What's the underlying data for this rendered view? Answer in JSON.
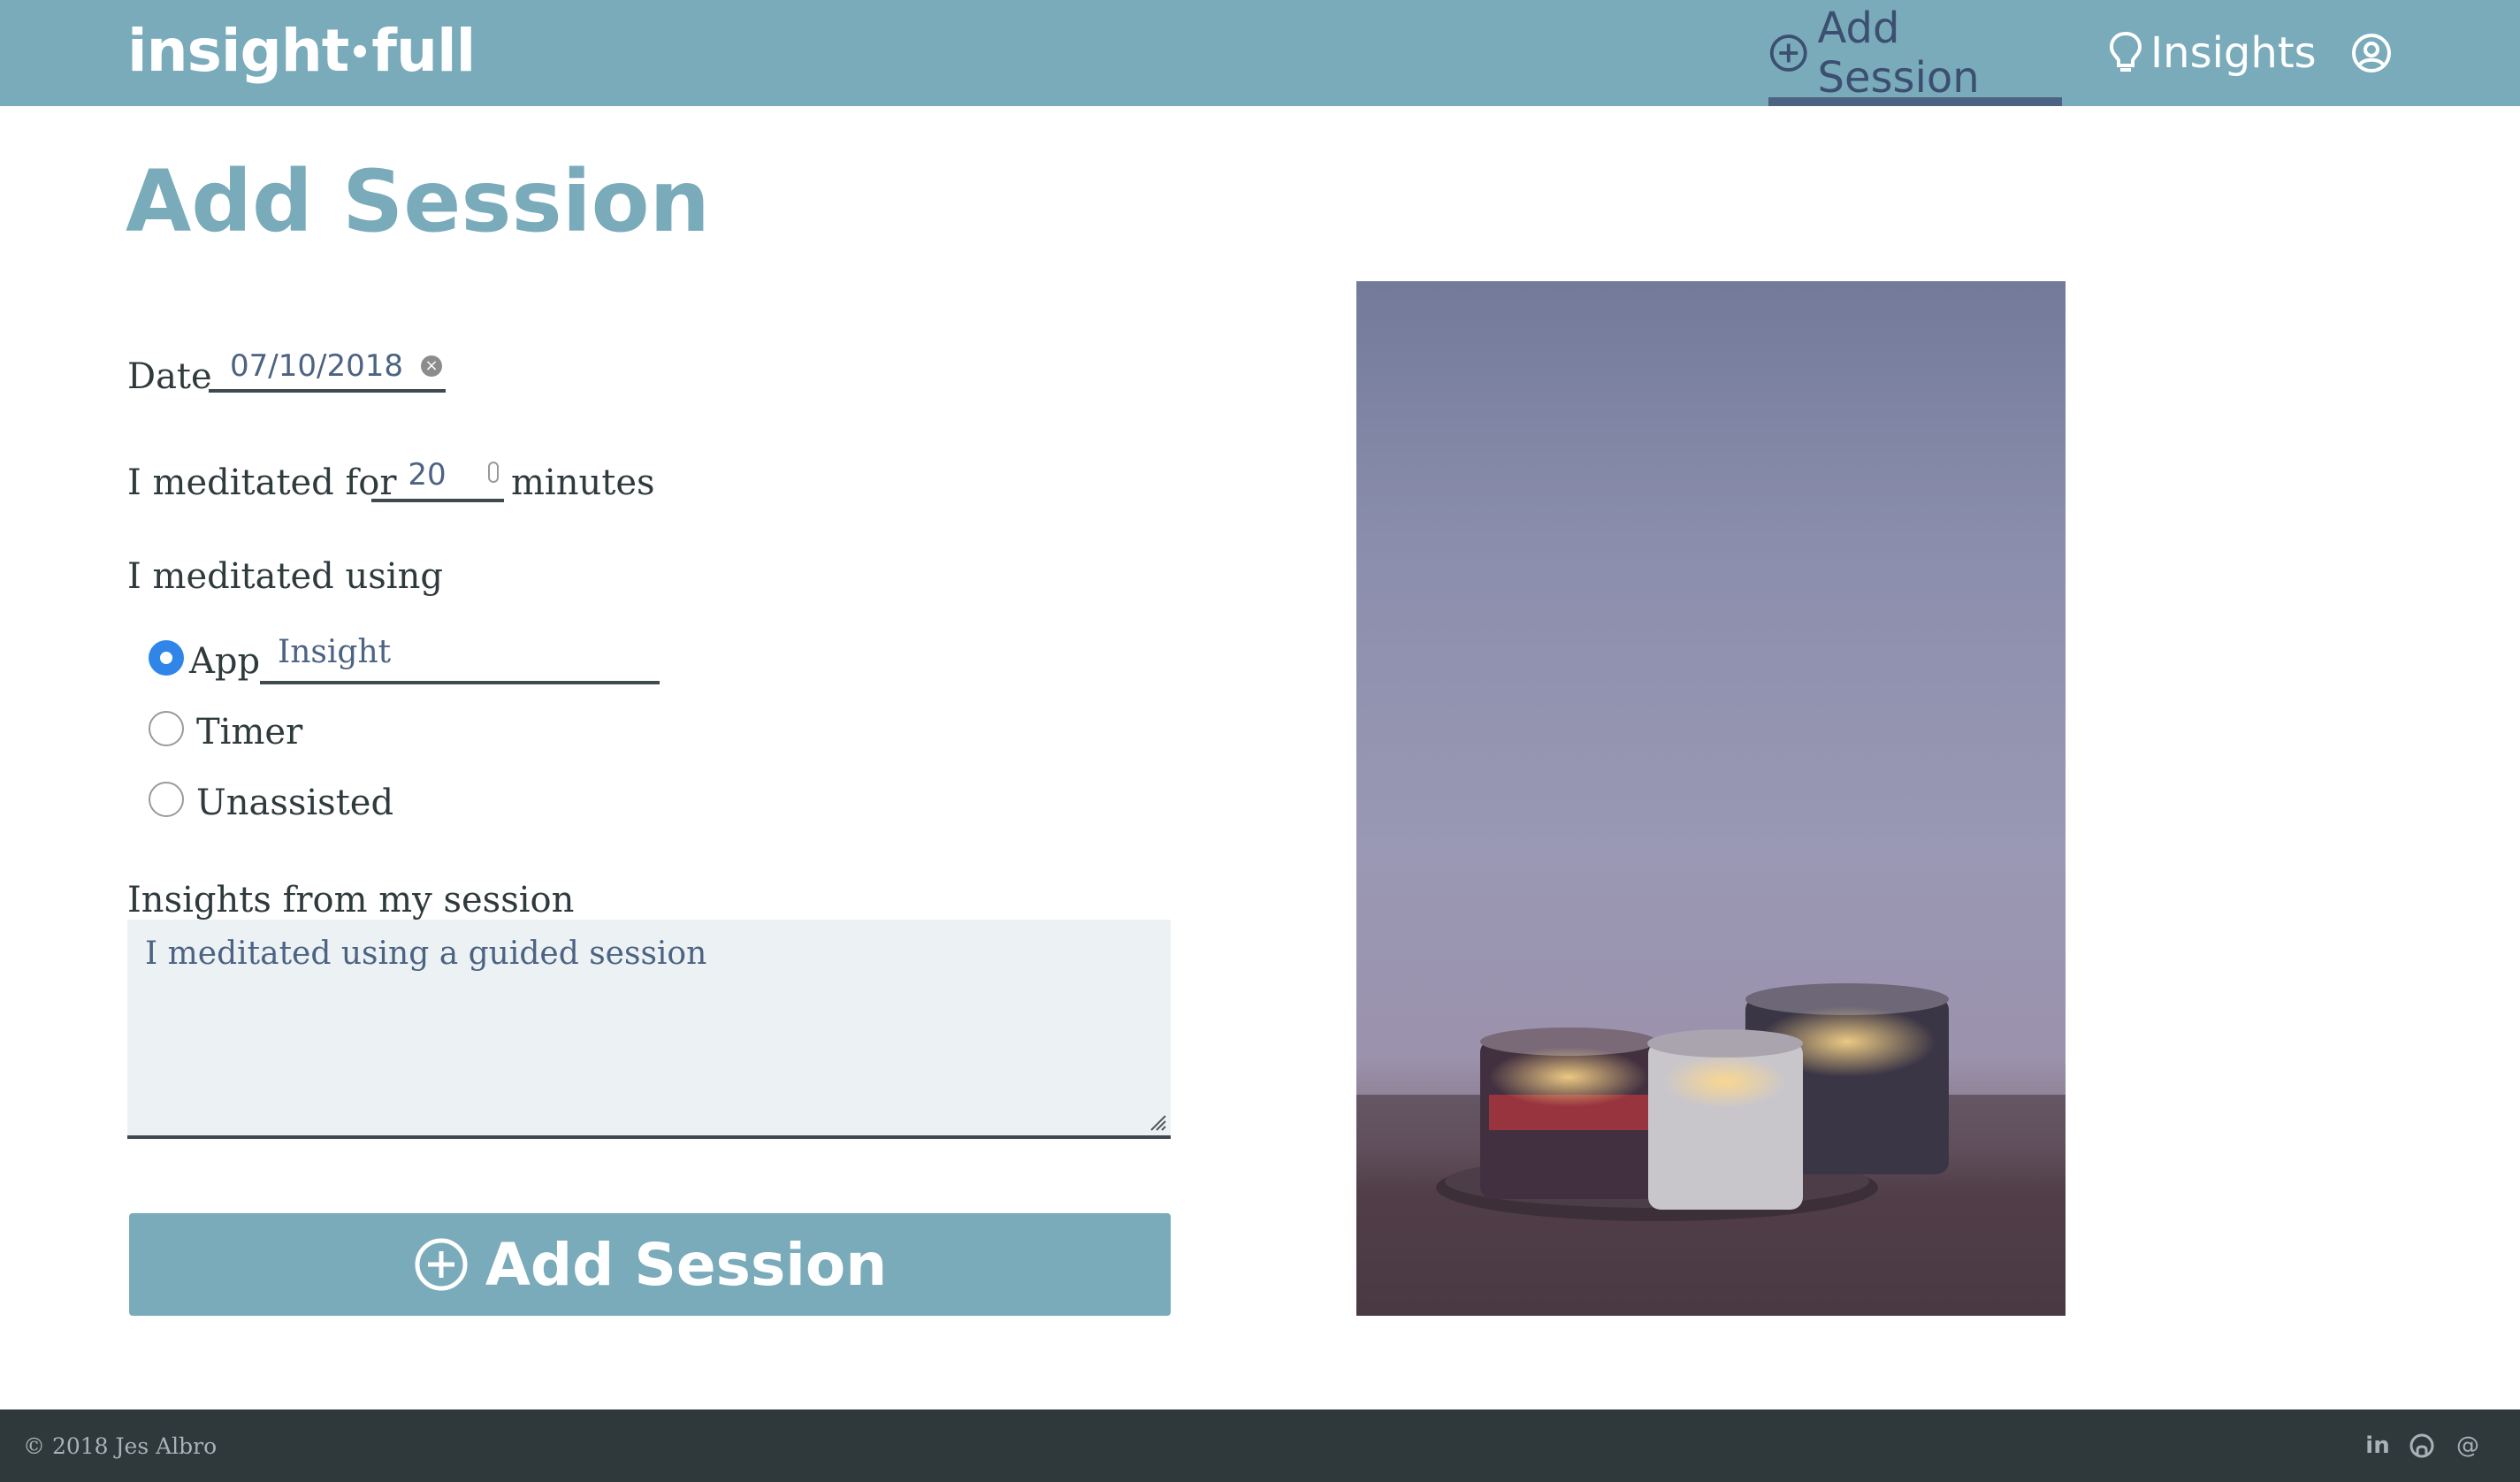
{
  "nav": {
    "brand_left": "insight",
    "brand_right": "full",
    "add_session": "Add Session",
    "insights": "Insights",
    "active_tab": "Add Session"
  },
  "page": {
    "title": "Add Session"
  },
  "form": {
    "date_label": "Date",
    "date_value": "07/10/2018",
    "duration_prefix": "I meditated for",
    "duration_value": "20",
    "duration_suffix": "minutes",
    "using_label": "I meditated using",
    "options": [
      {
        "label": "App",
        "checked": true
      },
      {
        "label": "Timer",
        "checked": false
      },
      {
        "label": "Unassisted",
        "checked": false
      }
    ],
    "app_value": "Insight",
    "insights_label": "Insights from my session",
    "insights_value": "I meditated using a guided session",
    "submit_label": "Add Session"
  },
  "footer": {
    "copyright": "© 2018 Jes Albro",
    "icons": [
      "linkedin-icon",
      "github-icon",
      "email-icon"
    ]
  },
  "colors": {
    "navbar": "#79abba",
    "active_tab": "#3c4f70",
    "title": "#79abba",
    "button": "#79abba",
    "radio_checked": "#2f86e8",
    "footer": "#2f383b"
  }
}
